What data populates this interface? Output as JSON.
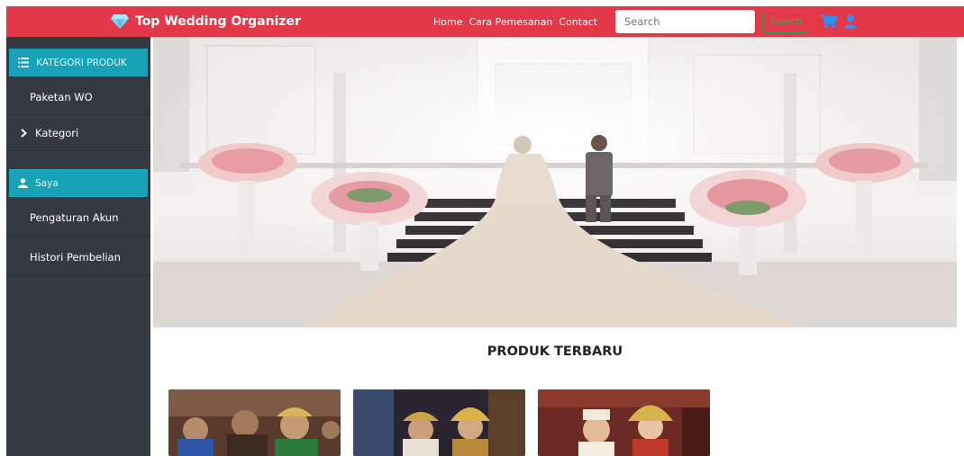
{
  "navbar": {
    "brand_title": "Top Wedding Organizer",
    "links": [
      "Home",
      "Cara Pemesanan",
      "Contact"
    ],
    "search_placeholder": "Search",
    "search_button": "Search",
    "colors": {
      "bar": "#e23848",
      "accent": "#1e90ff",
      "search_btn": "#3aa866"
    }
  },
  "sidebar": {
    "kategori_header": "KATEGORI PRODUK",
    "items": [
      "Paketan WO",
      "Kategori"
    ],
    "saya_header": "Saya",
    "account_items": [
      "Pengaturan Akun",
      "Histori Pembelian"
    ]
  },
  "main": {
    "section_title": "PRODUK TERBARU"
  },
  "icons": [
    "diamond-icon",
    "cart-icon",
    "user-icon",
    "list-icon",
    "chevron-right-icon",
    "user-icon"
  ]
}
